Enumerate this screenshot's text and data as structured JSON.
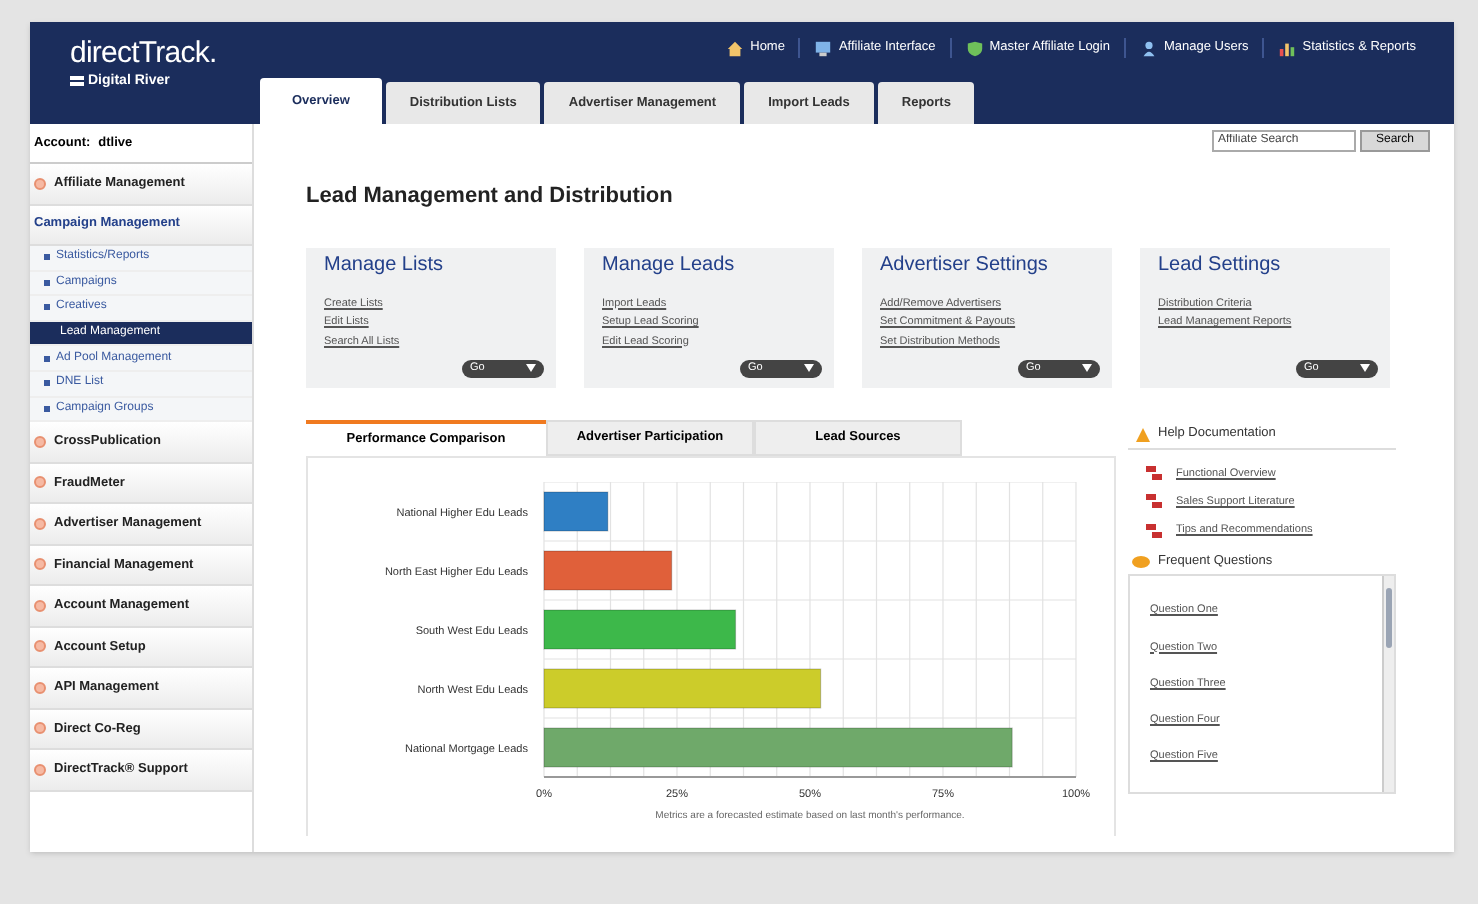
{
  "header": {
    "logo": "directTrack.",
    "sublogo": "Digital River",
    "links": [
      {
        "label": "Home",
        "kind": "home"
      },
      {
        "label": "Affiliate Interface",
        "kind": "monitor"
      },
      {
        "label": "Master Affiliate Login",
        "kind": "shield"
      },
      {
        "label": "Manage Users",
        "kind": "user"
      },
      {
        "label": "Statistics & Reports",
        "kind": "chart"
      }
    ]
  },
  "tabs": [
    {
      "label": "Overview",
      "selected": true
    },
    {
      "label": "Distribution Lists",
      "selected": false
    },
    {
      "label": "Advertiser Management",
      "selected": false
    },
    {
      "label": "Import Leads",
      "selected": false
    },
    {
      "label": "Reports",
      "selected": false
    }
  ],
  "search": {
    "placeholder": "Affiliate Search",
    "button": "Search"
  },
  "sidebar": {
    "account_label": "Account:",
    "account": "dtlive",
    "items": [
      {
        "label": "Affiliate Management",
        "expanded": false
      },
      {
        "label": "Campaign Management",
        "expanded": true,
        "children": [
          {
            "label": "Statistics/Reports",
            "selected": false
          },
          {
            "label": "Campaigns",
            "selected": false
          },
          {
            "label": "Creatives",
            "selected": false
          },
          {
            "label": "Lead Management",
            "selected": true
          },
          {
            "label": "Ad Pool Management",
            "selected": false
          },
          {
            "label": "DNE List",
            "selected": false
          },
          {
            "label": "Campaign Groups",
            "selected": false
          }
        ]
      },
      {
        "label": "CrossPublication",
        "expanded": false
      },
      {
        "label": "FraudMeter",
        "expanded": false
      },
      {
        "label": "Advertiser Management",
        "expanded": false
      },
      {
        "label": "Financial Management",
        "expanded": false
      },
      {
        "label": "Account Management",
        "expanded": false
      },
      {
        "label": "Account Setup",
        "expanded": false
      },
      {
        "label": "API Management",
        "expanded": false
      },
      {
        "label": "Direct Co-Reg",
        "expanded": false
      },
      {
        "label": "DirectTrack® Support",
        "expanded": false
      }
    ]
  },
  "page_title": "Lead Management and Distribution",
  "cards": [
    {
      "title": "Manage Lists",
      "links": [
        "Create Lists",
        "Edit Lists",
        "Search All Lists"
      ],
      "button": "Go"
    },
    {
      "title": "Manage Leads",
      "links": [
        "Import Leads",
        "Setup Lead Scoring",
        "Edit Lead Scoring"
      ],
      "button": "Go"
    },
    {
      "title": "Advertiser Settings",
      "links": [
        "Add/Remove Advertisers",
        "Set Commitment & Payouts",
        "Set Distribution Methods"
      ],
      "button": "Go"
    },
    {
      "title": "Lead Settings",
      "links": [
        "Distribution Criteria",
        "Lead Management Reports"
      ],
      "button": "Go"
    }
  ],
  "chart_tabs": [
    {
      "label": "Performance Comparison",
      "selected": true
    },
    {
      "label": "Advertiser Participation",
      "selected": false
    },
    {
      "label": "Lead Sources",
      "selected": false
    }
  ],
  "chart_data": {
    "type": "bar",
    "orientation": "horizontal",
    "categories": [
      "National Higher Edu Leads",
      "North East Higher Edu Leads",
      "South West Edu Leads",
      "North West Edu Leads",
      "National Mortgage Leads"
    ],
    "series": [
      {
        "values": [
          0.12,
          0.24,
          0.36,
          0.52,
          0.88
        ]
      }
    ],
    "grid": true,
    "xlim": [
      0,
      1
    ],
    "xticks": [
      {
        "value": 0,
        "label": "0%"
      },
      {
        "value": 0.25,
        "label": "25%"
      },
      {
        "value": 0.5,
        "label": "50%"
      },
      {
        "value": 0.75,
        "label": "75%"
      },
      {
        "value": 1,
        "label": "100%"
      }
    ]
  },
  "chart_note": "Metrics are a forecasted estimate based on last month's performance.",
  "help": {
    "title": "Help Documentation",
    "links": [
      "Functional Overview",
      "Sales Support Literature",
      "Tips and Recommendations"
    ]
  },
  "faq": {
    "title": "Frequent Questions",
    "links": [
      "Question One",
      "Question Two",
      "Question Three",
      "Question Four",
      "Question Five"
    ]
  }
}
